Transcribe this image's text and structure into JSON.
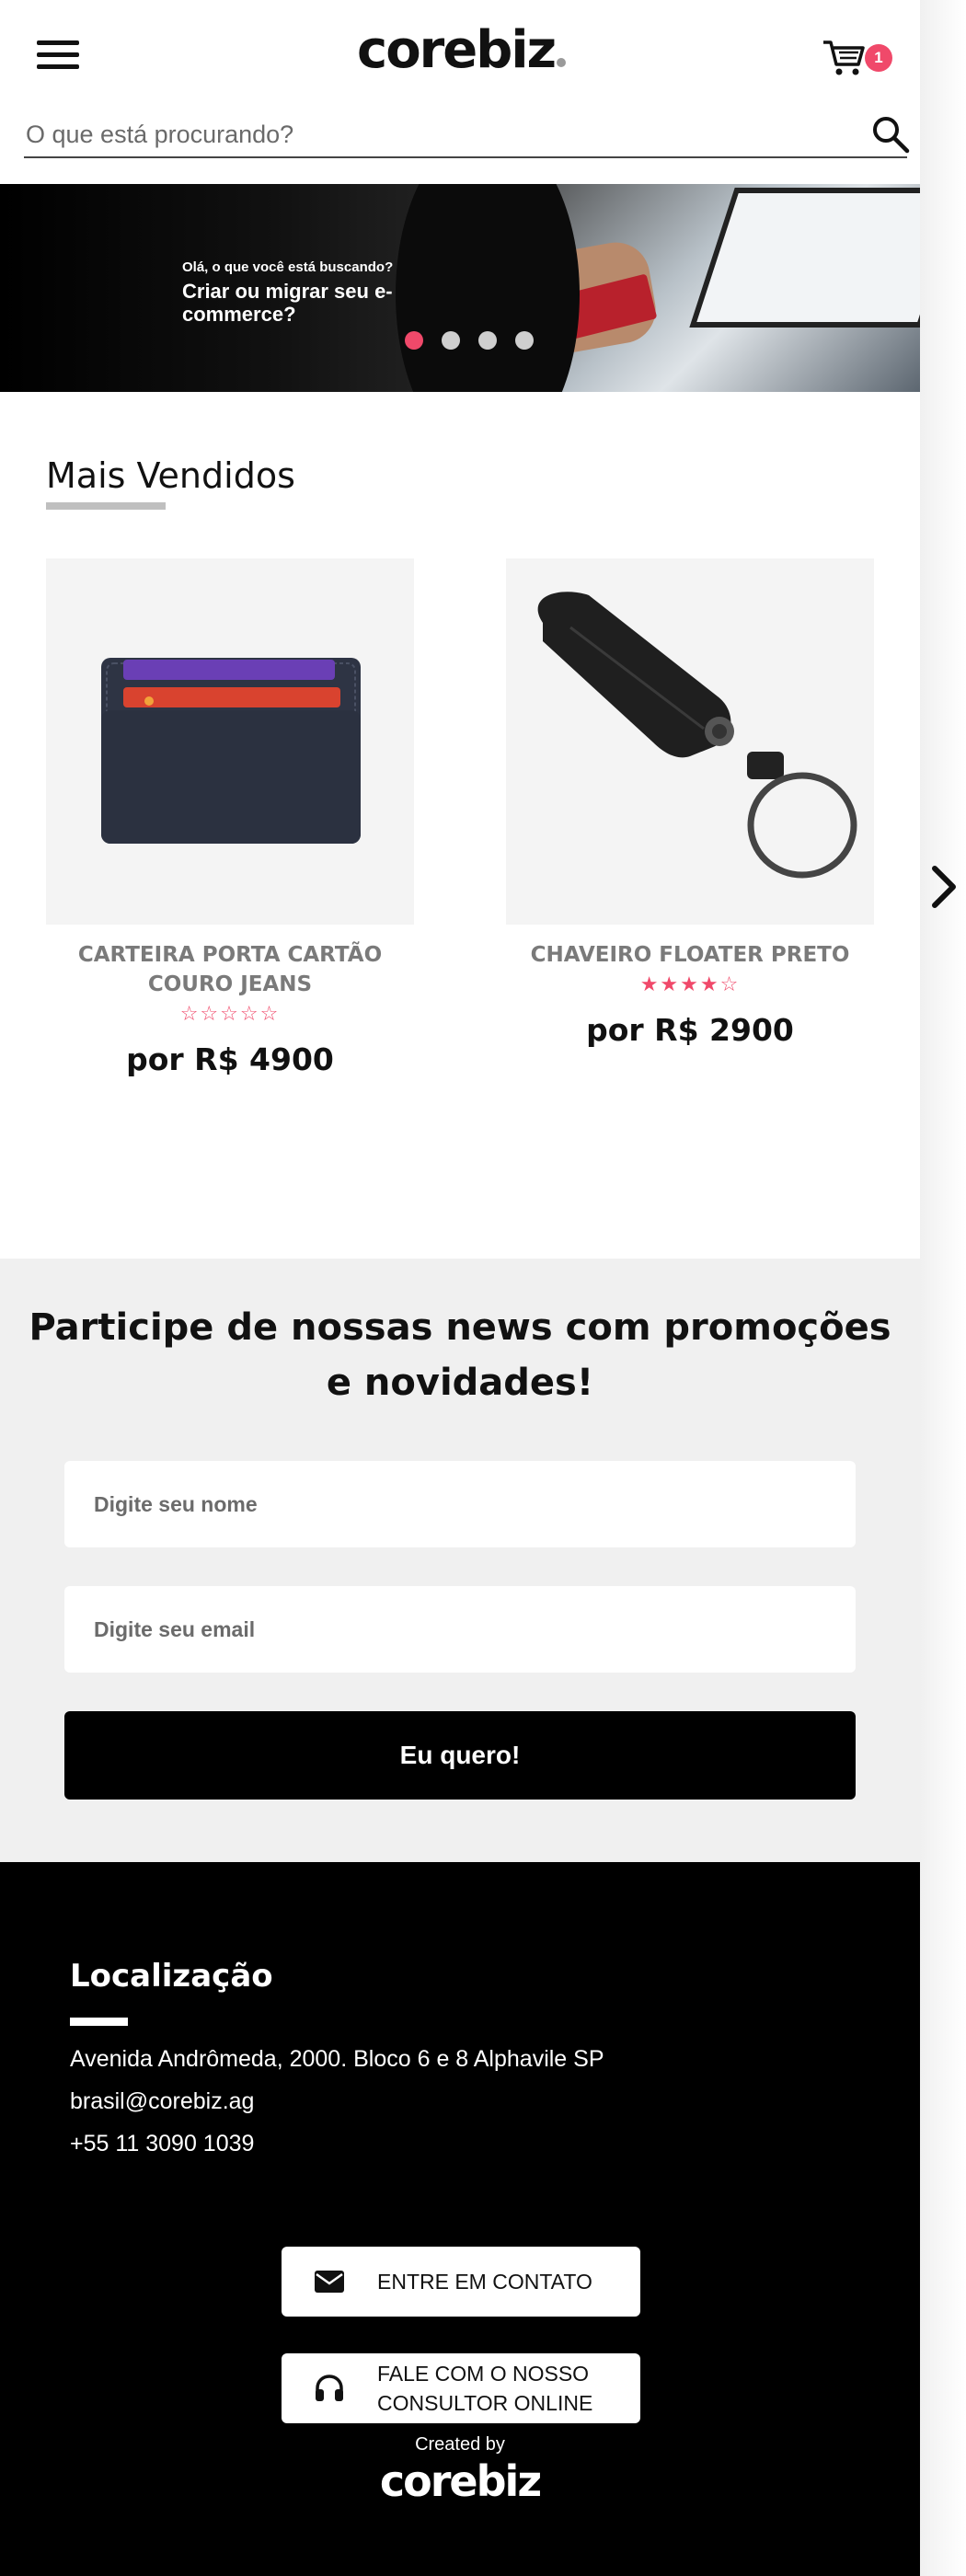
{
  "header": {
    "logo_text": "corebiz",
    "cart_count": "1",
    "search_placeholder": "O que está procurando?"
  },
  "banner": {
    "small_text": "Olá, o que você está buscando?",
    "headline": "Criar ou migrar seu e-commerce?",
    "slide_count": 4,
    "active_slide": 1
  },
  "best_sellers": {
    "title": "Mais Vendidos",
    "products": [
      {
        "name": "CARTEIRA PORTA CARTÃO COURO JEANS",
        "rating": 0,
        "rating_stars": "☆☆☆☆☆",
        "price": "por R$ 4900"
      },
      {
        "name": "CHAVEIRO FLOATER PRETO",
        "rating": 4,
        "rating_stars": "★★★★☆",
        "price": "por R$ 2900"
      }
    ]
  },
  "newsletter": {
    "title": "Participe de nossas news com promoções e novidades!",
    "name_placeholder": "Digite seu nome",
    "email_placeholder": "Digite seu email",
    "button_label": "Eu quero!"
  },
  "footer": {
    "location_title": "Localização",
    "address": "Avenida Andrômeda, 2000. Bloco 6 e 8 Alphavile SP",
    "email": "brasil@corebiz.ag",
    "phone": "+55 11 3090 1039",
    "contact_button": "ENTRE EM CONTATO",
    "consultant_button_line1": "FALE COM O NOSSO",
    "consultant_button_line2": "CONSULTOR ONLINE",
    "created_by": "Created by",
    "created_logo": "corebiz"
  },
  "colors": {
    "accent": "#f0496a",
    "footer_bg": "#000000",
    "newsletter_bg": "#f0f0f0"
  },
  "icons": [
    "hamburger-menu-icon",
    "cart-icon",
    "search-icon",
    "chevron-right-icon",
    "mail-icon",
    "headset-icon"
  ]
}
